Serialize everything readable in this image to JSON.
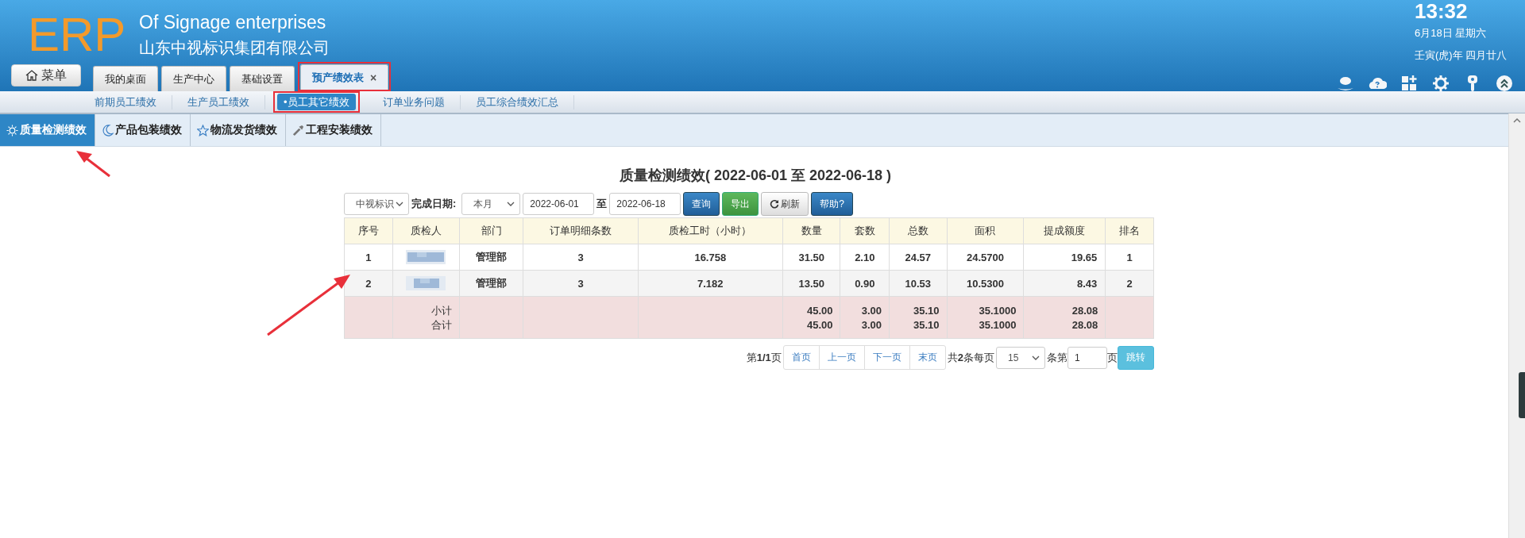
{
  "header": {
    "logo": "ERP",
    "title": "Of Signage enterprises",
    "company": "山东中视标识集团有限公司",
    "menu_button": "菜单",
    "clock": {
      "time": "13:32",
      "date": "6月18日 星期六",
      "lunar": "壬寅(虎)年 四月廿八"
    }
  },
  "tabs": [
    {
      "label": "我的桌面",
      "selected": false,
      "highlighted": false
    },
    {
      "label": "生产中心",
      "selected": false,
      "highlighted": false
    },
    {
      "label": "基础设置",
      "selected": false,
      "highlighted": false
    },
    {
      "label": "预产绩效表",
      "selected": true,
      "highlighted": true,
      "close": "×"
    }
  ],
  "subnav": [
    {
      "label": "前期员工绩效",
      "selected": false,
      "highlighted": false
    },
    {
      "label": "生产员工绩效",
      "selected": false,
      "highlighted": false
    },
    {
      "label": "•员工其它绩效",
      "selected": true,
      "highlighted": true
    },
    {
      "label": "订单业务问题",
      "selected": false,
      "highlighted": false
    },
    {
      "label": "员工综合绩效汇总",
      "selected": false,
      "highlighted": false
    }
  ],
  "module_tabs": [
    {
      "label": "质量检测绩效",
      "selected": true
    },
    {
      "label": "产品包装绩效",
      "selected": false
    },
    {
      "label": "物流发货绩效",
      "selected": false
    },
    {
      "label": "工程安装绩效",
      "selected": false
    }
  ],
  "report": {
    "title": "质量检测绩效( 2022-06-01 至 2022-06-18 )",
    "filters": {
      "company": "中视标识",
      "date_label": "完成日期:",
      "period": "本月",
      "from": "2022-06-01",
      "to_label": "至",
      "to": "2022-06-18"
    },
    "buttons": [
      {
        "label": "查询",
        "kind": "primary"
      },
      {
        "label": "导出",
        "kind": "success"
      },
      {
        "label": "刷新",
        "kind": "refresh"
      },
      {
        "label": "帮助?",
        "kind": "primary"
      }
    ],
    "columns": [
      "序号",
      "质检人",
      "部门",
      "订单明细条数",
      "质检工时（小时）",
      "数量",
      "套数",
      "总数",
      "面积",
      "提成额度",
      "排名"
    ],
    "rows": [
      {
        "cells": [
          "1",
          "",
          "管理部",
          "3",
          "16.758",
          "31.50",
          "2.10",
          "24.57",
          "24.5700",
          "19.65",
          "1"
        ]
      },
      {
        "cells": [
          "2",
          "",
          "管理部",
          "3",
          "7.182",
          "13.50",
          "0.90",
          "10.53",
          "10.5300",
          "8.43",
          "2"
        ]
      }
    ],
    "summary": [
      {
        "label": "小计",
        "values": [
          "45.00",
          "3.00",
          "35.10",
          "35.1000",
          "28.08"
        ]
      },
      {
        "label": "合计",
        "values": [
          "45.00",
          "3.00",
          "35.10",
          "35.1000",
          "28.08"
        ]
      }
    ],
    "pagination": {
      "page_info": "第**1/1**页",
      "links": [
        "首页",
        "上一页",
        "下一页",
        "末页"
      ],
      "total": "共**2**条每页",
      "page_size": "15",
      "unit": "条第",
      "page": "1",
      "page_label": "页",
      "go": "跳转"
    }
  }
}
